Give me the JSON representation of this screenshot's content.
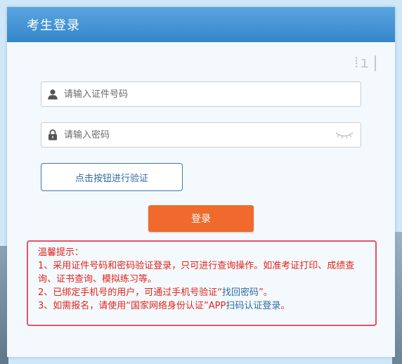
{
  "header": {
    "title": "考生登录"
  },
  "form": {
    "id_placeholder": "请输入证件号码",
    "password_placeholder": "请输入密码",
    "verify_button_label": "点击按钮进行验证",
    "login_button_label": "登录"
  },
  "icons": {
    "id_field": "user-icon",
    "password_field": "lock-icon",
    "password_toggle": "eye-closed-icon"
  },
  "tips": {
    "title": "温馨提示：",
    "line1": "1、采用证件号码和密码验证登录，只可进行查询操作。如准考证打印、成绩查询、证书查询、模拟练习等。",
    "line2_prefix": "2、已绑定手机号的用户，可通过手机号验证“",
    "line2_link": "找回密码",
    "line2_suffix": "”。",
    "line3_prefix": "3、如需报名，请使用“国家网络身份认证”APP",
    "line3_link": "扫码认证登录",
    "line3_suffix": "。"
  },
  "colors": {
    "header_blue": "#3585c9",
    "login_orange": "#ef6a2c",
    "tips_red": "#e0251b",
    "tips_border": "#e85068",
    "link_blue": "#2d6aa7"
  }
}
